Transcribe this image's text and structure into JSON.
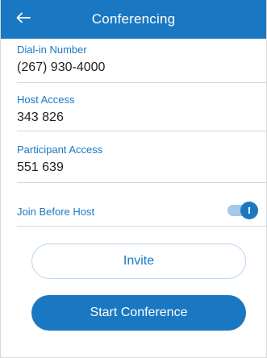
{
  "colors": {
    "accent": "#1a78c2",
    "header_bg": "#1a78c2",
    "divider": "#d6d6d6",
    "toggle_track": "#a5c9e8"
  },
  "header": {
    "back_icon": "arrow-left-icon",
    "title": "Conferencing"
  },
  "fields": {
    "dial_in": {
      "label": "Dial-in Number",
      "value": "(267) 930-4000"
    },
    "host": {
      "label": "Host Access",
      "value": "343 826"
    },
    "participant": {
      "label": "Participant Access",
      "value": "551 639"
    }
  },
  "join_before_host": {
    "label": "Join Before Host",
    "on": true
  },
  "buttons": {
    "invite": "Invite",
    "start": "Start Conference"
  }
}
